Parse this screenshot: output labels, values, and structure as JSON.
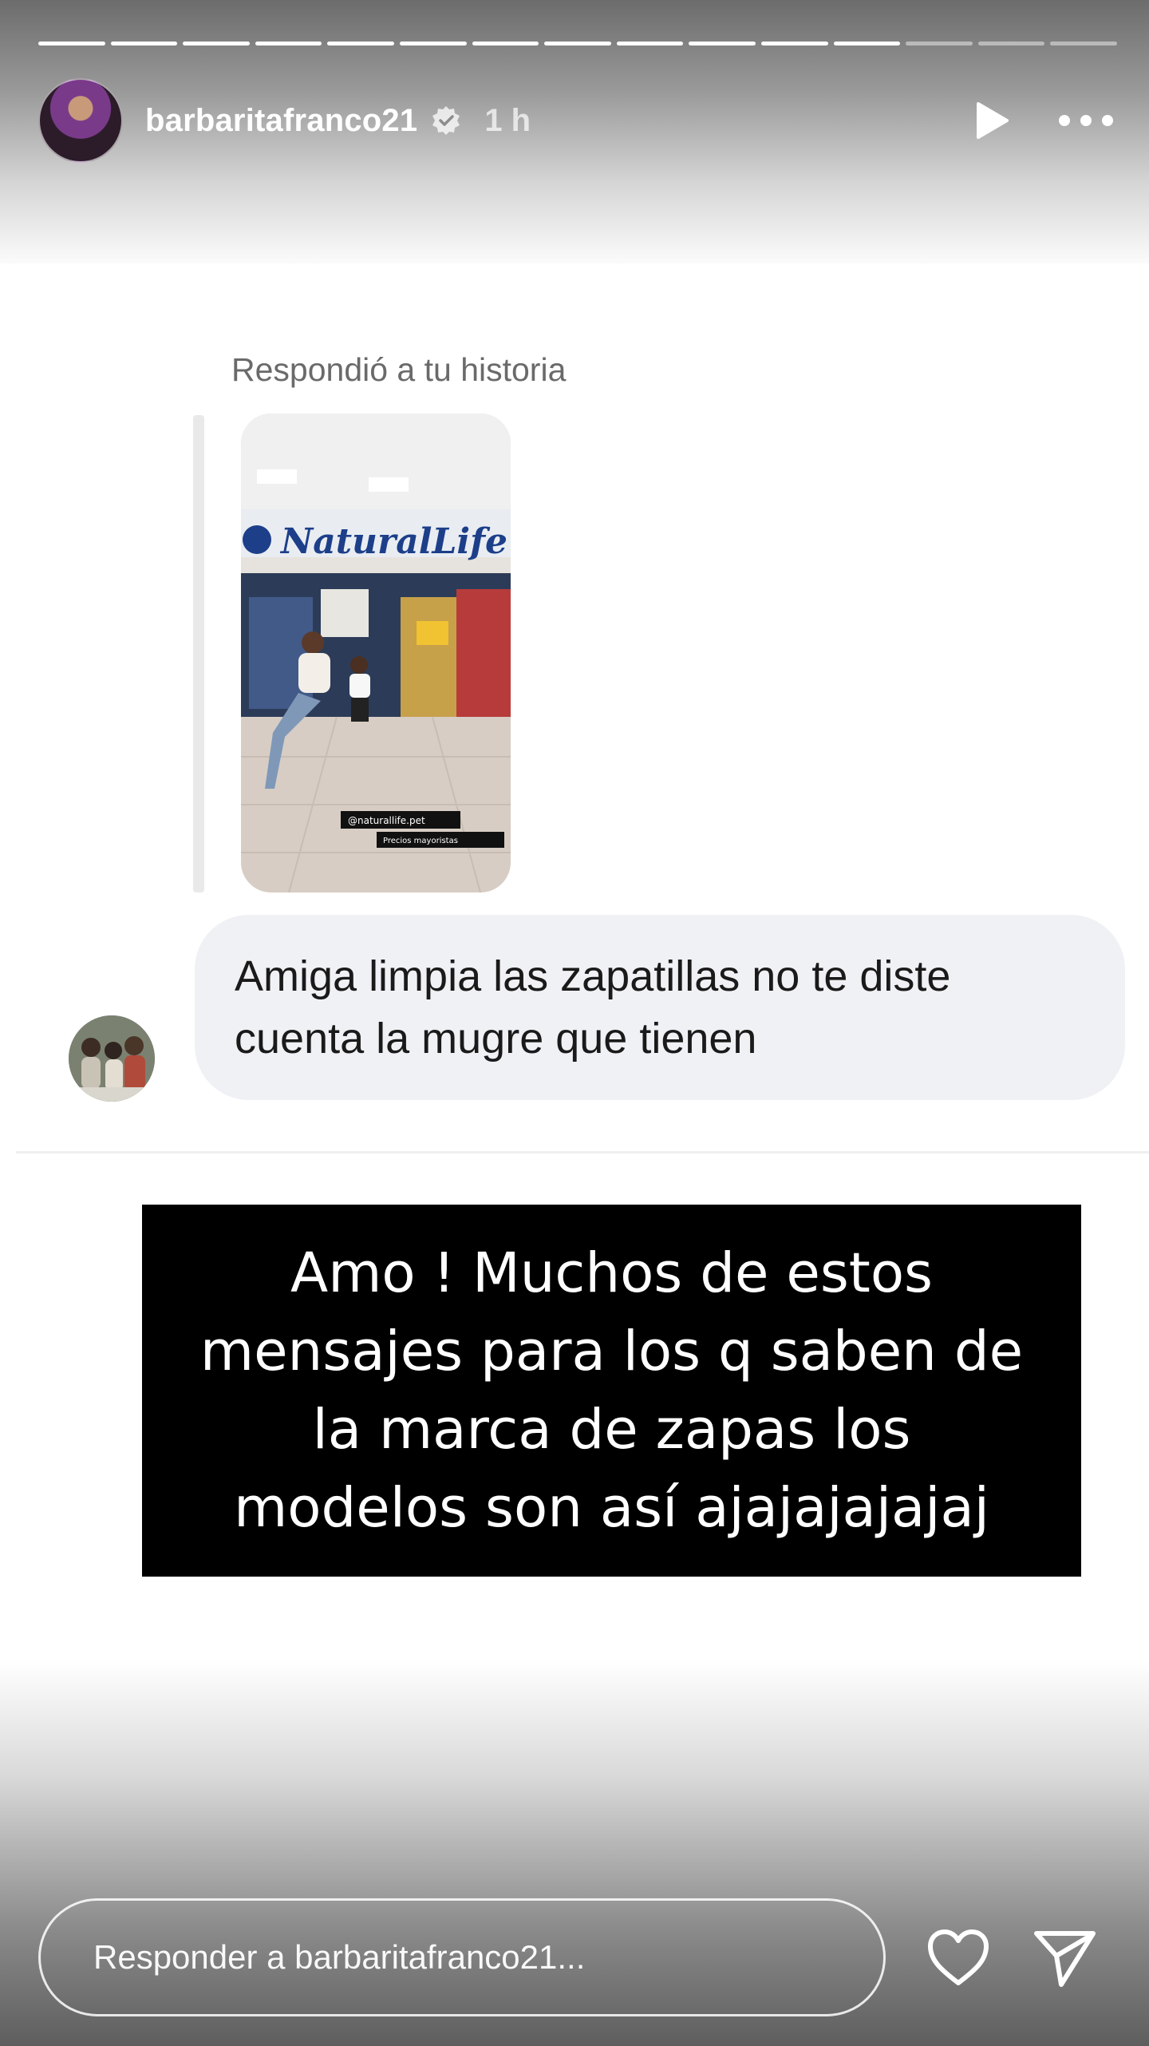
{
  "story": {
    "segments_total": 15,
    "segments_done": 12
  },
  "header": {
    "username": "barbaritafranco21",
    "time": "1 h",
    "avatar_icon": "profile-avatar",
    "verified_icon": "verified-badge-icon",
    "play_icon": "play-icon",
    "more_icon": "more-options-icon"
  },
  "reply_card": {
    "label": "Respondió a tu historia",
    "message": "Amiga limpia las zapatillas no te diste cuenta la mugre que tienen",
    "thumb": {
      "store_sign": "NaturalLife",
      "tag": "@naturallife.pet",
      "subtag": "Precios mayoristas"
    }
  },
  "caption": {
    "text": "Amo ! Muchos de estos mensajes para los q saben de la marca de zapas los modelos son así ajajajajajaj"
  },
  "footer": {
    "reply_placeholder": "Responder a barbaritafranco21...",
    "heart_icon": "heart-icon",
    "send_icon": "send-icon"
  },
  "colors": {
    "bubble": "#eff1f4",
    "caption_bg": "#000000",
    "label_text": "#6a6a6a"
  }
}
